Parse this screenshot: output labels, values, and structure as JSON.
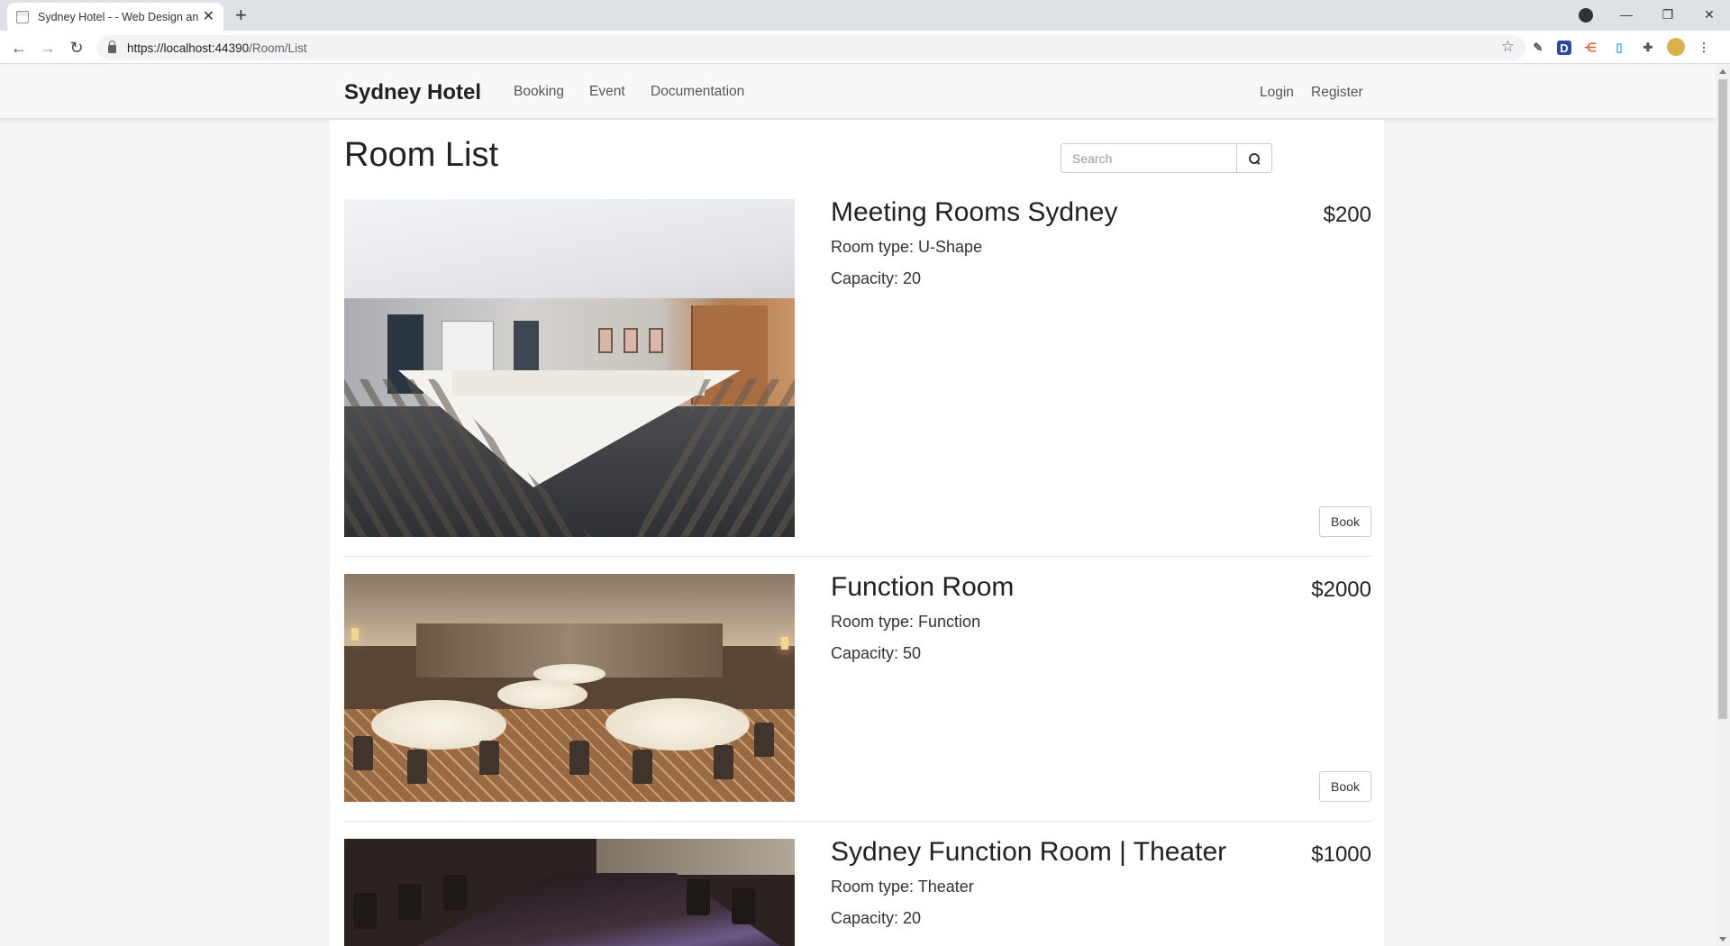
{
  "browser": {
    "tab_title": "Sydney Hotel - - Web Design and",
    "new_tab": "+",
    "close": "✕",
    "url_host": "https://localhost:44390",
    "url_path": "/Room/List",
    "win_min": "—",
    "win_restore": "❐",
    "win_close": "✕"
  },
  "navbar": {
    "brand": "Sydney Hotel",
    "links": [
      "Booking",
      "Event",
      "Documentation"
    ],
    "login": "Login",
    "register": "Register"
  },
  "page": {
    "title": "Room List",
    "search_placeholder": "Search"
  },
  "rooms": [
    {
      "name": "Meeting Rooms Sydney",
      "price": "$200",
      "type": "Room type: U-Shape",
      "capacity": "Capacity: 20",
      "button": "Book"
    },
    {
      "name": "Function Room",
      "price": "$2000",
      "type": "Room type: Function",
      "capacity": "Capacity: 50",
      "button": "Book"
    },
    {
      "name": "Sydney Function Room | Theater",
      "price": "$1000",
      "type": "Room type: Theater",
      "capacity": "Capacity: 20"
    }
  ],
  "colors": {
    "navbar_bg": "#f8f8f8",
    "page_bg": "#f5f5f5",
    "content_bg": "#ffffff"
  }
}
